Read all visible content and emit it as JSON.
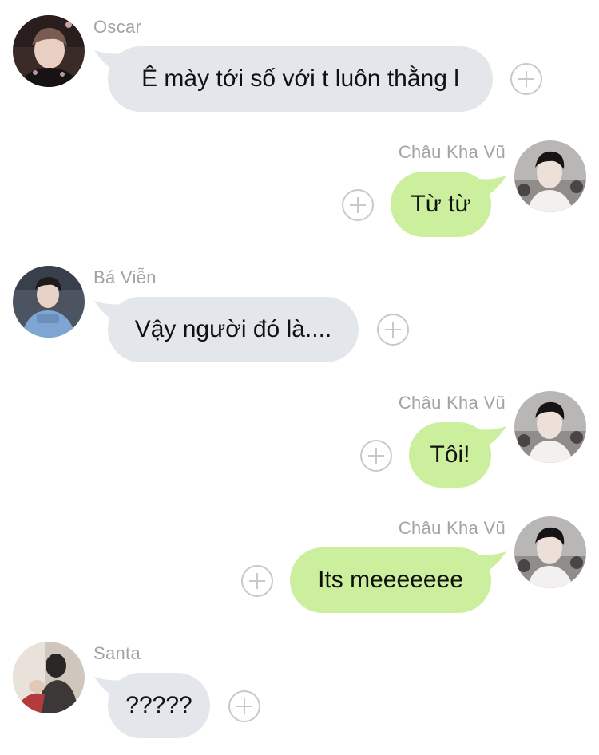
{
  "colors": {
    "incoming_bubble": "#e3e6ea",
    "outgoing_bubble": "#cbef9c",
    "sender_name": "#a3a3a3",
    "add_icon": "#c9c9c9"
  },
  "messages": [
    {
      "sender": "Oscar",
      "direction": "incoming",
      "text": "Ê mày tới số với t luôn thằng l",
      "avatar_icon": "avatar-oscar-icon",
      "action_icon": "add-reaction-icon"
    },
    {
      "sender": "Châu Kha Vũ",
      "direction": "outgoing",
      "text": "Từ từ",
      "avatar_icon": "avatar-chau-kha-vu-icon",
      "action_icon": "add-reaction-icon"
    },
    {
      "sender": "Bá Viễn",
      "direction": "incoming",
      "text": "Vậy người đó là....",
      "avatar_icon": "avatar-ba-vien-icon",
      "action_icon": "add-reaction-icon"
    },
    {
      "sender": "Châu Kha Vũ",
      "direction": "outgoing",
      "text": "Tôi!",
      "avatar_icon": "avatar-chau-kha-vu-icon",
      "action_icon": "add-reaction-icon"
    },
    {
      "sender": "Châu Kha Vũ",
      "direction": "outgoing",
      "text": "Its meeeeeee",
      "avatar_icon": "avatar-chau-kha-vu-icon",
      "action_icon": "add-reaction-icon"
    },
    {
      "sender": "Santa",
      "direction": "incoming",
      "text": "?????",
      "avatar_icon": "avatar-santa-icon",
      "action_icon": "add-reaction-icon"
    }
  ]
}
